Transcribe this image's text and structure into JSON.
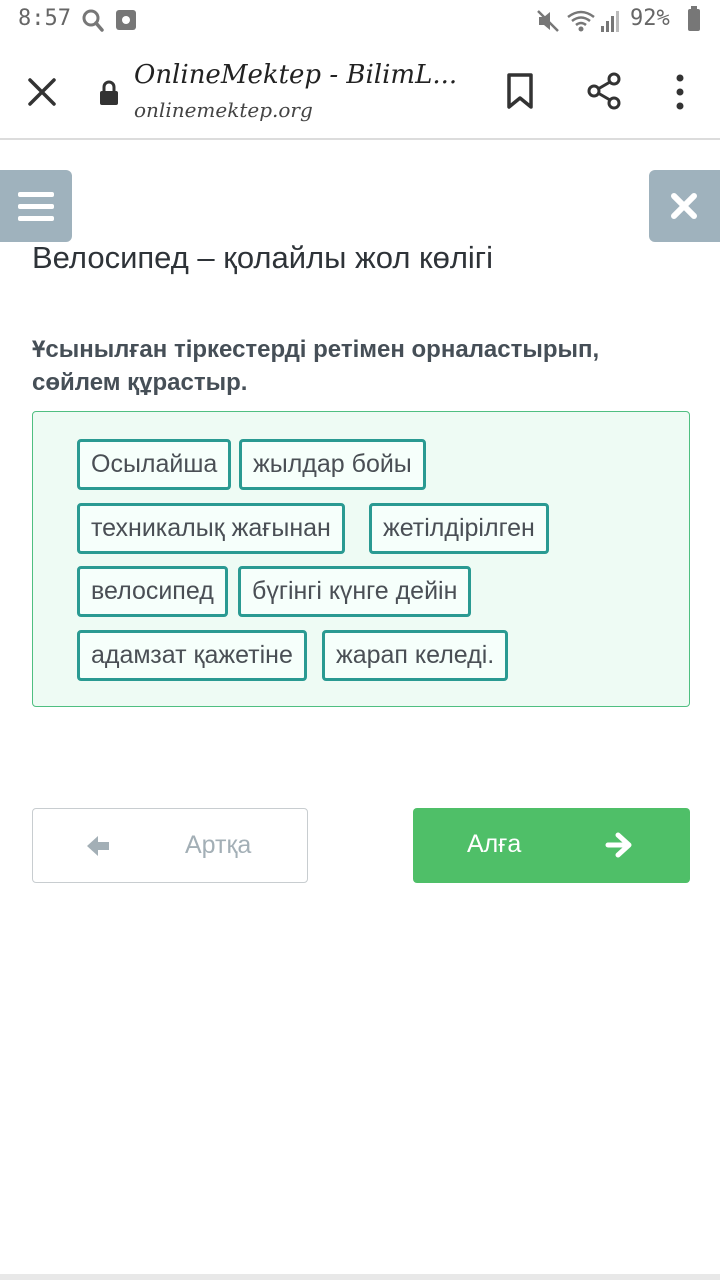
{
  "status_bar": {
    "time": "8:57",
    "battery": "92%"
  },
  "browser": {
    "site_title": "OnlineMektep - BilimL...",
    "site_url": "onlinemektep.org",
    "icons": [
      "close-icon",
      "lock-icon",
      "bookmark-icon",
      "share-icon",
      "more-vertical-icon"
    ]
  },
  "page": {
    "title": "Велосипед – қолайлы жол көлігі",
    "instruction": "Ұсынылған тіркестерді ретімен орналастырып, сөйлем құрастыр.",
    "words": [
      "Осылайша",
      "жылдар бойы",
      "техникалық жағынан",
      "жетілдірілген",
      "велосипед",
      "бүгінгі күнге дейін",
      "адамзат қажетіне",
      "жарап келеді."
    ]
  },
  "navigation": {
    "back_label": "Артқа",
    "next_label": "Алға"
  },
  "colors": {
    "accent_green": "#4fbf68",
    "word_border": "#2a9a92",
    "panel_button": "#9fb2bd"
  }
}
